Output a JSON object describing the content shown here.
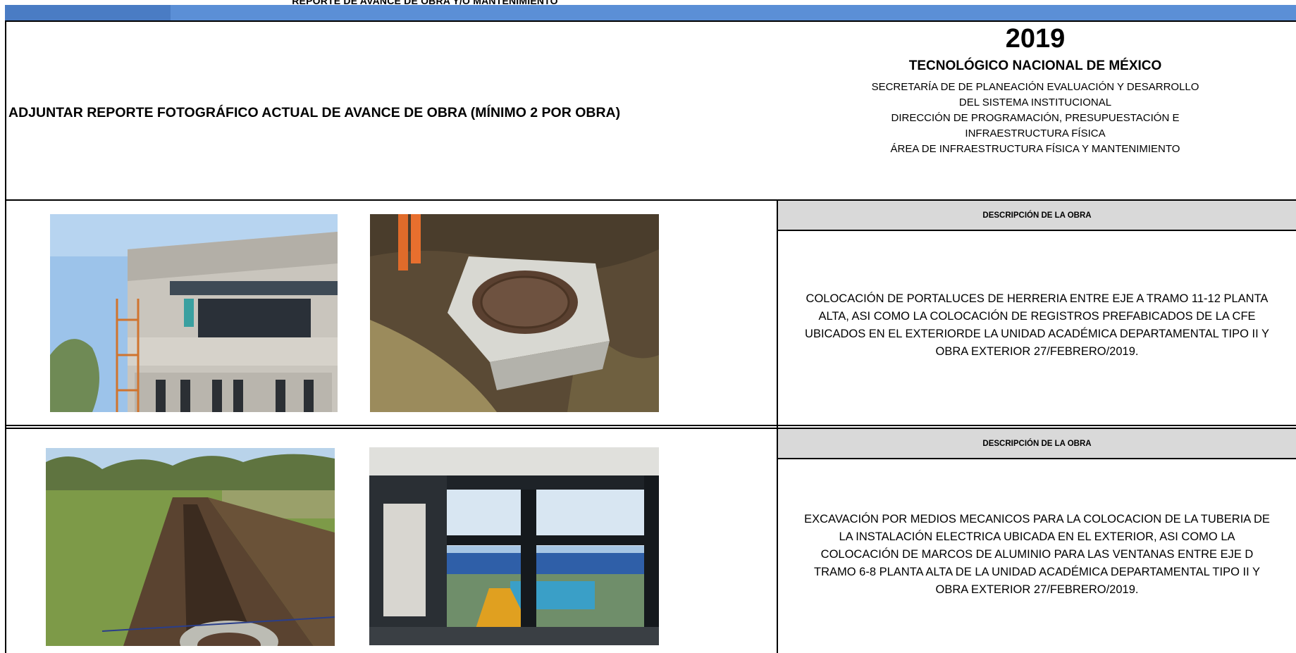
{
  "report": {
    "top_title": "REPORTE DE AVANCE DE OBRA Y/O MANTENIMIENTO",
    "instruction": "ADJUNTAR REPORTE FOTOGRÁFICO ACTUAL DE AVANCE DE OBRA (MÍNIMO 2 POR OBRA)",
    "year": "2019",
    "institution": "TECNOLÓGICO NACIONAL DE MÉXICO",
    "departments": [
      "SECRETARÍA DE  DE PLANEACIÓN EVALUACIÓN Y DESARROLLO",
      "DEL SISTEMA INSTITUCIONAL",
      "DIRECCIÓN DE PROGRAMACIÓN, PRESUPUESTACIÓN E",
      "INFRAESTRUCTURA FÍSICA",
      "ÁREA DE INFRAESTRUCTURA FÍSICA  Y MANTENIMIENTO"
    ]
  },
  "entries": [
    {
      "header": "DESCRIPCIÓN DE LA OBRA",
      "lines": [
        "COLOCACIÓN DE PORTALUCES DE HERRERIA ENTRE EJE A TRAMO 11-12 PLANTA",
        "ALTA, ASI COMO LA COLOCACIÓN DE REGISTROS PREFABICADOS DE LA CFE",
        "UBICADOS EN EL EXTERIORDE LA UNIDAD ACADÉMICA DEPARTAMENTAL TIPO II  Y",
        "OBRA EXTERIOR 27/FEBRERO/2019."
      ]
    },
    {
      "header": "DESCRIPCIÓN DE LA OBRA",
      "lines": [
        "EXCAVACIÓN POR MEDIOS MECANICOS PARA LA COLOCACION DE LA TUBERIA DE",
        "LA  INSTALACIÓN ELECTRICA UBICADA EN EL EXTERIOR, ASI COMO LA",
        "COLOCACIÓN DE MARCOS DE ALUMINIO PARA LAS VENTANAS ENTRE EJE D",
        "TRAMO 6-8 PLANTA ALTA DE LA UNIDAD ACADÉMICA DEPARTAMENTAL TIPO II  Y",
        "OBRA EXTERIOR 27/FEBRERO/2019."
      ]
    }
  ]
}
